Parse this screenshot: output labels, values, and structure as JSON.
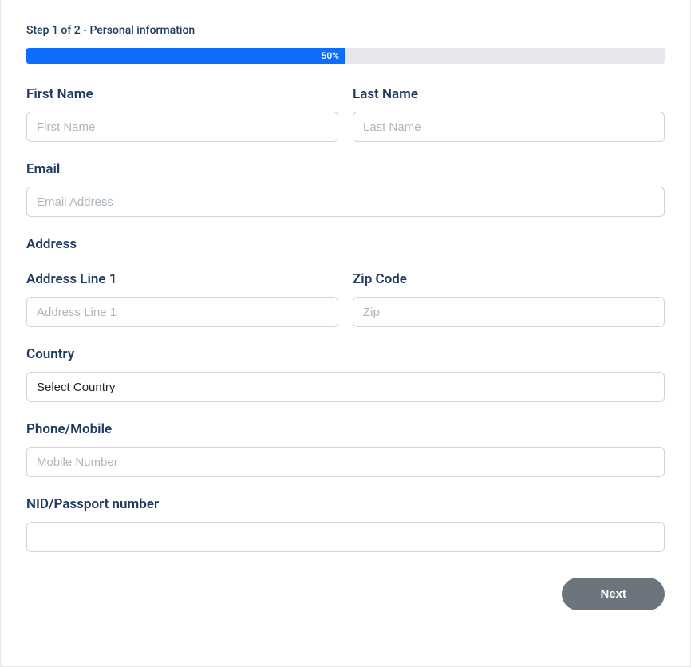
{
  "step": {
    "label": "Step 1 of 2 - Personal information",
    "progress_percent": "50%"
  },
  "fields": {
    "first_name": {
      "label": "First Name",
      "placeholder": "First Name",
      "value": ""
    },
    "last_name": {
      "label": "Last Name",
      "placeholder": "Last Name",
      "value": ""
    },
    "email": {
      "label": "Email",
      "placeholder": "Email Address",
      "value": ""
    },
    "address_heading": "Address",
    "address_line_1": {
      "label": "Address Line 1",
      "placeholder": "Address Line 1",
      "value": ""
    },
    "zip_code": {
      "label": "Zip Code",
      "placeholder": "Zip",
      "value": ""
    },
    "country": {
      "label": "Country",
      "selected": "Select Country"
    },
    "phone": {
      "label": "Phone/Mobile",
      "placeholder": "Mobile Number",
      "value": ""
    },
    "nid": {
      "label": "NID/Passport number",
      "placeholder": "",
      "value": ""
    }
  },
  "buttons": {
    "next": "Next"
  }
}
